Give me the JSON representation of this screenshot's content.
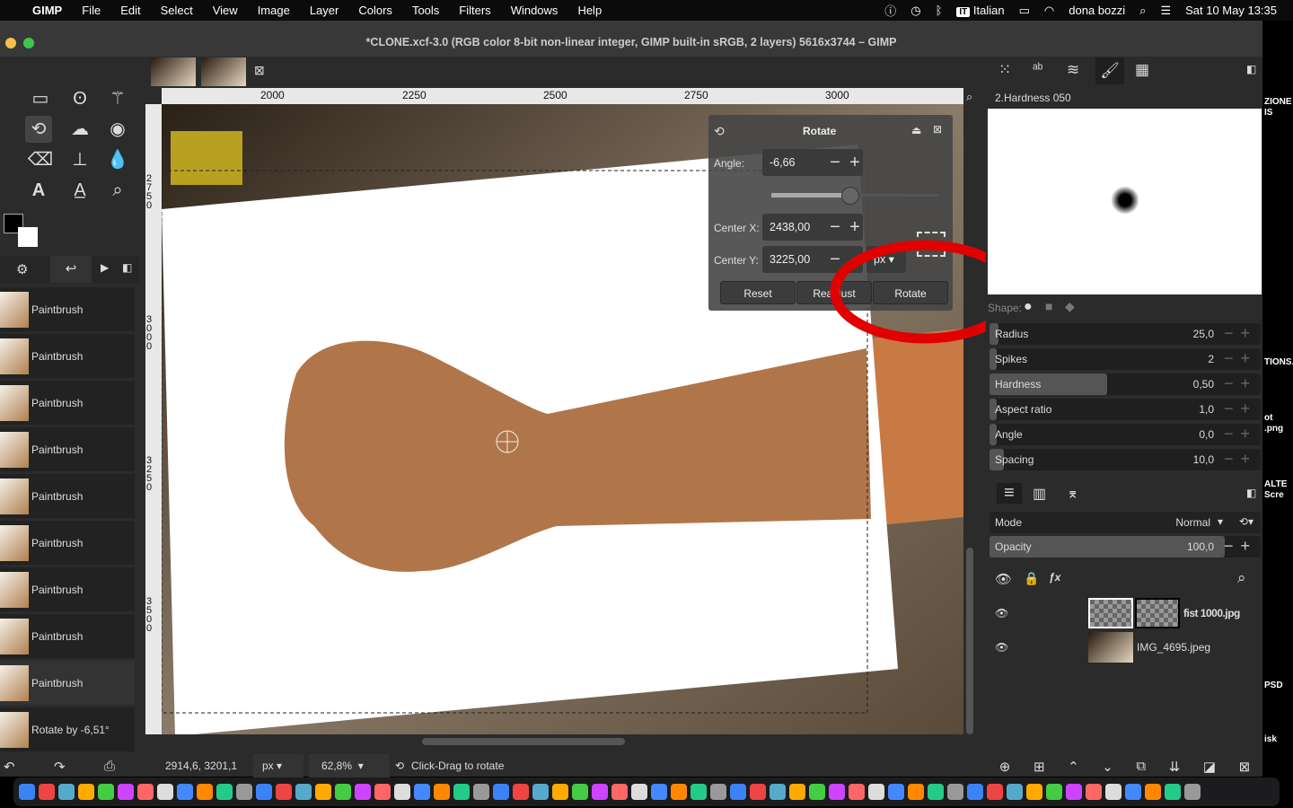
{
  "menubar": {
    "app": "GIMP",
    "items": [
      "File",
      "Edit",
      "Select",
      "View",
      "Image",
      "Layer",
      "Colors",
      "Tools",
      "Filters",
      "Windows",
      "Help"
    ],
    "input_source": "Italian",
    "user": "dona bozzi",
    "clock": "Sat 10 May  13:35"
  },
  "window": {
    "title": "*CLONE.xcf-3.0 (RGB color 8-bit non-linear integer, GIMP built-in sRGB, 2 layers) 5616x3744 – GIMP"
  },
  "ruler": {
    "top": [
      "2000",
      "2250",
      "2500",
      "2750",
      "3000"
    ],
    "left": [
      "2750",
      "3000",
      "3250",
      "3500"
    ]
  },
  "history": {
    "items": [
      "Paintbrush",
      "Paintbrush",
      "Paintbrush",
      "Paintbrush",
      "Paintbrush",
      "Paintbrush",
      "Paintbrush",
      "Paintbrush",
      "Paintbrush",
      "Rotate by -6,51°"
    ]
  },
  "rotate_dialog": {
    "title": "Rotate",
    "angle_label": "Angle:",
    "angle": "-6,66",
    "center_x_label": "Center X:",
    "center_x": "2438,00",
    "center_y_label": "Center Y:",
    "center_y": "3225,00",
    "unit": "px",
    "reset": "Reset",
    "readjust": "Readjust",
    "rotate": "Rotate",
    "angle_slider_fraction": 0.5
  },
  "brushes": {
    "selected": "2.Hardness 050",
    "shape_label": "Shape:"
  },
  "brush_options": [
    {
      "name": "Radius",
      "value": "25,0",
      "fill": 0.04
    },
    {
      "name": "Spikes",
      "value": "2",
      "fill": 0.03
    },
    {
      "name": "Hardness",
      "value": "0,50",
      "fill": 0.5
    },
    {
      "name": "Aspect ratio",
      "value": "1,0",
      "fill": 0.03
    },
    {
      "name": "Angle",
      "value": "0,0",
      "fill": 0.03
    },
    {
      "name": "Spacing",
      "value": "10,0",
      "fill": 0.06
    }
  ],
  "layers": {
    "mode_label": "Mode",
    "mode": "Normal",
    "opacity_label": "Opacity",
    "opacity": "100,0",
    "items": [
      {
        "name": "fist 1000.jpg"
      },
      {
        "name": "IMG_4695.jpeg"
      }
    ]
  },
  "status": {
    "coords": "2914,6, 3201,1",
    "unit": "px",
    "zoom": "62,8%",
    "message": "Click-Drag to rotate"
  },
  "desktop": {
    "labels": [
      "ZIONE",
      "IS",
      "TIONS.",
      "ot",
      ".png",
      "ALTE",
      "Scre",
      "PSD",
      "isk"
    ]
  },
  "colors": {
    "annotation": "#e00000"
  }
}
